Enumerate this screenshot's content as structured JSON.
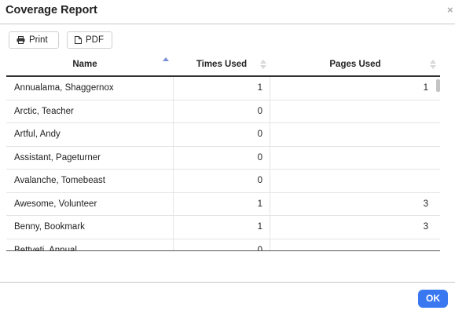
{
  "dialog": {
    "title": "Coverage Report",
    "close_glyph": "×"
  },
  "toolbar": {
    "print_label": "Print",
    "print_icon": "printer-icon",
    "pdf_label": "PDF",
    "pdf_icon": "document-icon"
  },
  "table": {
    "columns": [
      {
        "label": "Name",
        "sort": "ascending"
      },
      {
        "label": "Times Used",
        "sort": "none"
      },
      {
        "label": "Pages Used",
        "sort": "none"
      }
    ],
    "rows": [
      {
        "name": "Annualama, Shaggernox",
        "times_used": "1",
        "pages_used": "1"
      },
      {
        "name": "Arctic, Teacher",
        "times_used": "0",
        "pages_used": ""
      },
      {
        "name": "Artful, Andy",
        "times_used": "0",
        "pages_used": ""
      },
      {
        "name": "Assistant, Pageturner",
        "times_used": "0",
        "pages_used": ""
      },
      {
        "name": "Avalanche, Tomebeast",
        "times_used": "0",
        "pages_used": ""
      },
      {
        "name": "Awesome, Volunteer",
        "times_used": "1",
        "pages_used": "3"
      },
      {
        "name": "Benny, Bookmark",
        "times_used": "1",
        "pages_used": "3"
      },
      {
        "name": "Bettyeti, Annual",
        "times_used": "0",
        "pages_used": ""
      }
    ]
  },
  "footer": {
    "ok_label": "OK"
  },
  "colors": {
    "accent": "#3a78f2",
    "sort_active": "#7a8fd8"
  }
}
